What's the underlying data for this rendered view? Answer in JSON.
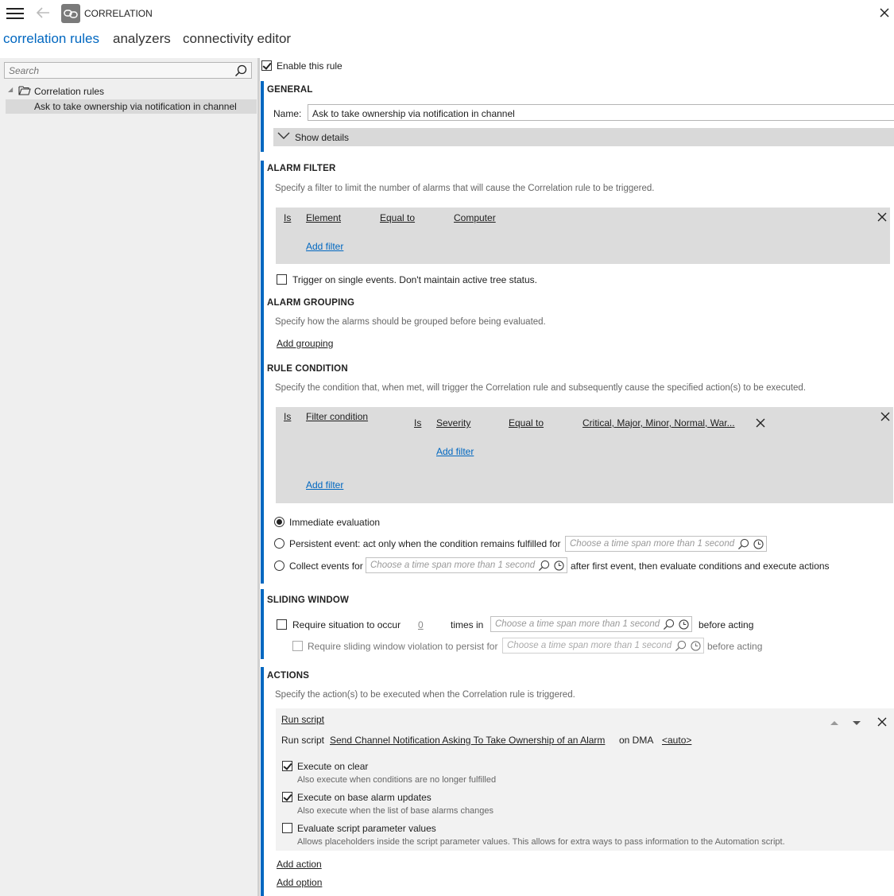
{
  "window": {
    "title": "CORRELATION",
    "menu_icon": "hamburger-menu-icon",
    "back_icon": "back-arrow-icon",
    "app_icon": "correlation-link-icon",
    "close_icon": "close-icon"
  },
  "tabs": [
    {
      "label": "correlation rules",
      "active": true
    },
    {
      "label": "analyzers",
      "active": false
    },
    {
      "label": "connectivity editor",
      "active": false
    }
  ],
  "sidebar": {
    "search_placeholder": "Search",
    "tree": {
      "folder_label": "Correlation rules",
      "items": [
        {
          "label": "Ask to take ownership via notification in channel",
          "selected": true
        }
      ]
    }
  },
  "enable_rule": {
    "label": "Enable this rule",
    "checked": true
  },
  "general": {
    "title": "GENERAL",
    "name_label": "Name:",
    "name_value": "Ask to take ownership via notification in channel",
    "show_details": "Show details"
  },
  "alarm_filter": {
    "title": "ALARM FILTER",
    "description": "Specify a filter to limit the number of alarms that will cause the Correlation rule to be triggered.",
    "filter": {
      "is": "Is",
      "field": "Element",
      "operator": "Equal to",
      "value": "Computer"
    },
    "add_filter": "Add filter",
    "single_events_label": "Trigger on single events. Don't maintain active tree status.",
    "single_events_checked": false
  },
  "alarm_grouping": {
    "title": "ALARM GROUPING",
    "description": "Specify how the alarms should be grouped before being evaluated.",
    "add_grouping": "Add grouping"
  },
  "rule_condition": {
    "title": "RULE CONDITION",
    "description": "Specify the condition that, when met, will trigger the Correlation rule and subsequently cause the specified action(s) to be executed.",
    "outer_is": "Is",
    "outer_field": "Filter condition",
    "inner": {
      "is": "Is",
      "field": "Severity",
      "operator": "Equal to",
      "value": "Critical, Major, Minor, Normal, War..."
    },
    "inner_add_filter": "Add filter",
    "outer_add_filter": "Add filter",
    "evaluation": {
      "immediate": "Immediate evaluation",
      "persistent": "Persistent event: act only when the condition remains fulfilled for",
      "collect": "Collect events for",
      "collect_suffix": "after first event, then evaluate conditions and execute actions",
      "selected": "immediate"
    },
    "timespan_placeholder": "Choose a time span more than 1 second"
  },
  "sliding_window": {
    "title": "SLIDING WINDOW",
    "require_label": "Require situation to occur",
    "count": "0",
    "times_in": "times in",
    "before_acting": "before acting",
    "persist_label": "Require sliding window violation to persist for",
    "persist_before_acting": "before acting",
    "timespan_placeholder": "Choose a time span more than 1 second"
  },
  "actions": {
    "title": "ACTIONS",
    "description": "Specify the action(s) to be executed when the Correlation rule is triggered.",
    "action_type": "Run script",
    "run_script_label": "Run script",
    "script_name": "Send Channel Notification Asking To Take Ownership of an Alarm",
    "on_dma_label": "on DMA",
    "dma_value": "<auto>",
    "options": [
      {
        "label": "Execute on clear",
        "sub": "Also execute when conditions are no longer fulfilled",
        "checked": true
      },
      {
        "label": "Execute on base alarm updates",
        "sub": "Also execute when the list of base alarms changes",
        "checked": true
      },
      {
        "label": "Evaluate script parameter values",
        "sub": "Allows placeholders inside the script parameter values. This allows for extra ways to pass information to the Automation script.",
        "checked": false
      }
    ],
    "add_action": "Add action",
    "add_option": "Add option"
  }
}
